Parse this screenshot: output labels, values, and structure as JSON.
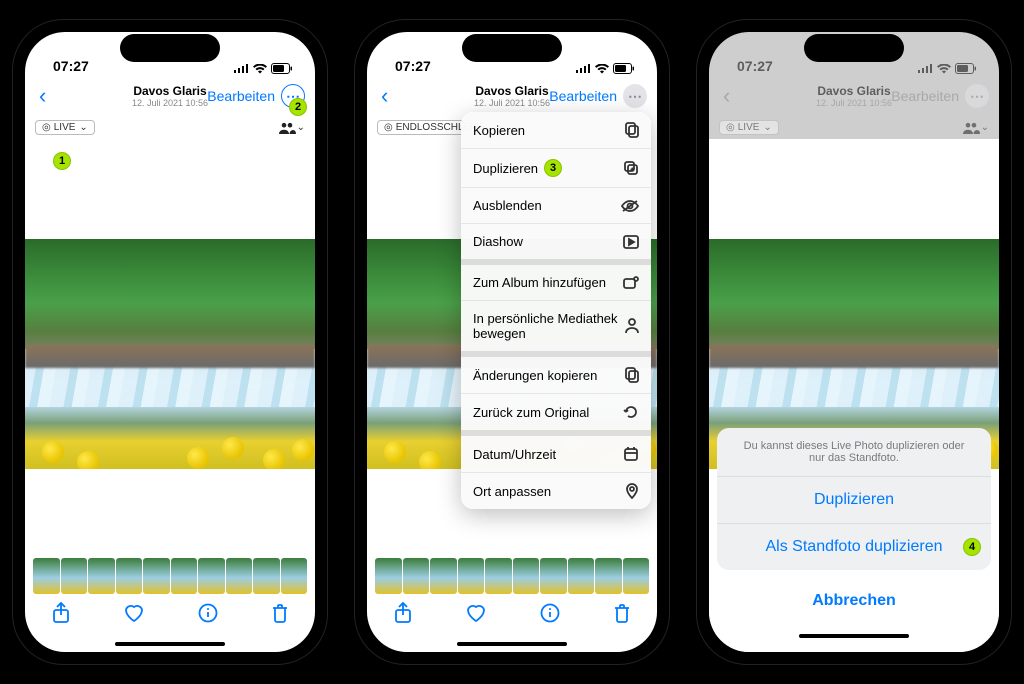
{
  "status": {
    "time": "07:27"
  },
  "nav": {
    "title": "Davos Glaris",
    "subtitle": "12. Juli 2021  10:56",
    "edit": "Bearbeiten"
  },
  "badge": {
    "live": "LIVE",
    "endless": "ENDLOSSCHLEIFE"
  },
  "menu": {
    "copy": "Kopieren",
    "duplicate": "Duplizieren",
    "hide": "Ausblenden",
    "slideshow": "Diashow",
    "addAlbum": "Zum Album hinzufügen",
    "moveLib": "In persönliche Mediathek bewegen",
    "copyEdits": "Änderungen kopieren",
    "revert": "Zurück zum Original",
    "datetime": "Datum/Uhrzeit",
    "location": "Ort anpassen"
  },
  "sheet": {
    "message": "Du kannst dieses Live Photo duplizieren oder nur das Standfoto.",
    "duplicate": "Duplizieren",
    "asStill": "Als Standfoto duplizieren",
    "cancel": "Abbrechen"
  },
  "callouts": {
    "c1": "1",
    "c2": "2",
    "c3": "3",
    "c4": "4"
  }
}
